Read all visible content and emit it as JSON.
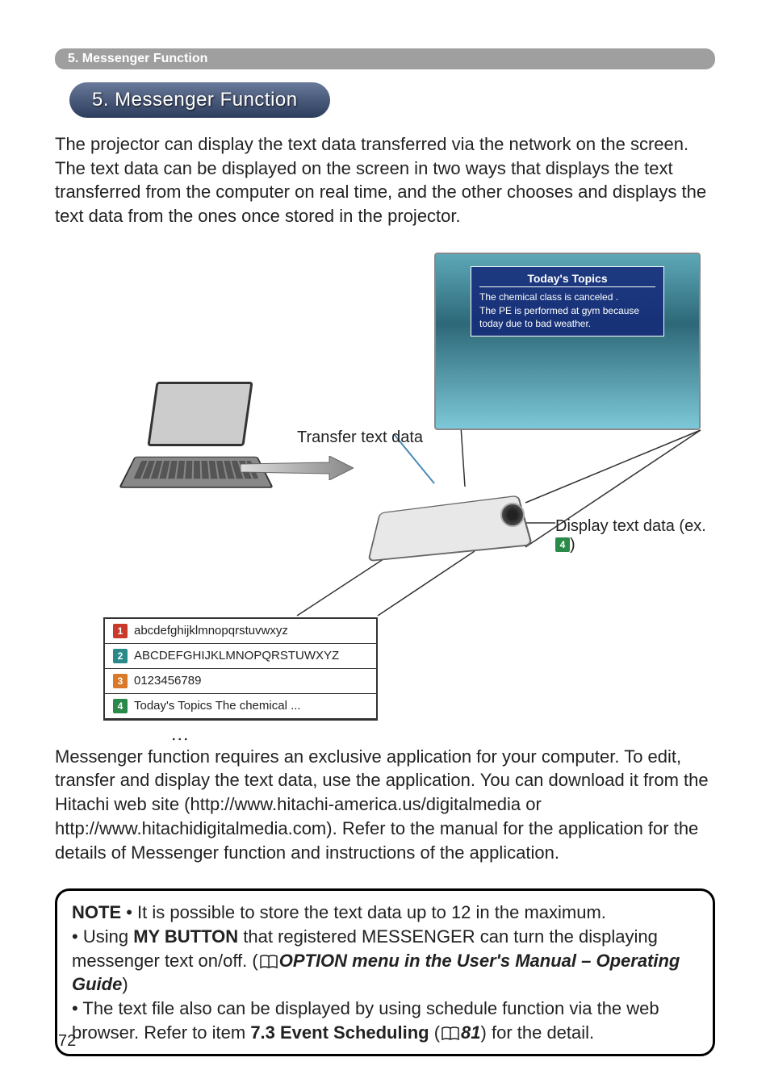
{
  "breadcrumb": "5. Messenger Function",
  "section_title": "5. Messenger Function",
  "intro_paragraph": "The projector can display the text data transferred via the network on the screen. The text data can be displayed on the screen in two ways that displays the text transferred from the computer on real time, and the other chooses and displays the text data from the ones once stored in the projector.",
  "diagram": {
    "transfer_label": "Transfer text data",
    "display_label_prefix": "Display text data (ex. ",
    "display_label_suffix": ")",
    "display_badge_num": "4",
    "screen": {
      "title": "Today's Topics",
      "body": "The chemical class is canceled .\nThe PE is performed at gym because today due to bad weather."
    },
    "stored_items": [
      {
        "num": "1",
        "badge": "red",
        "text": "abcdefghijklmnopqrstuvwxyz"
      },
      {
        "num": "2",
        "badge": "teal",
        "text": "ABCDEFGHIJKLMNOPQRSTUWXYZ"
      },
      {
        "num": "3",
        "badge": "orange",
        "text": "0123456789"
      },
      {
        "num": "4",
        "badge": "green",
        "text": "Today's Topics The chemical ..."
      }
    ]
  },
  "middle_paragraph": "Messenger function requires an exclusive application for your computer. To edit, transfer and display the text data, use the application. You can download it from the Hitachi web site (http://www.hitachi-america.us/digitalmedia or http://www.hitachidigitalmedia.com). Refer to the manual for the application for the details of Messenger function and instructions of the application.",
  "note": {
    "label": "NOTE",
    "line1": " • It is possible to store the text data up to 12 in the maximum.",
    "line2a": "• Using ",
    "line2b_bold": "MY BUTTON",
    "line2c": " that registered MESSENGER can turn the displaying messenger text on/off. (",
    "line2d_italic": "OPTION menu in the User's Manual – Operating Guide",
    "line2e": ")",
    "line3a": "• The text file also can be displayed by using schedule function via the web browser. Refer to item ",
    "line3b_bold": "7.3 Event Scheduling",
    "line3c": " (",
    "line3d_italic": "81",
    "line3e": ") for the detail."
  },
  "page_number": "72"
}
